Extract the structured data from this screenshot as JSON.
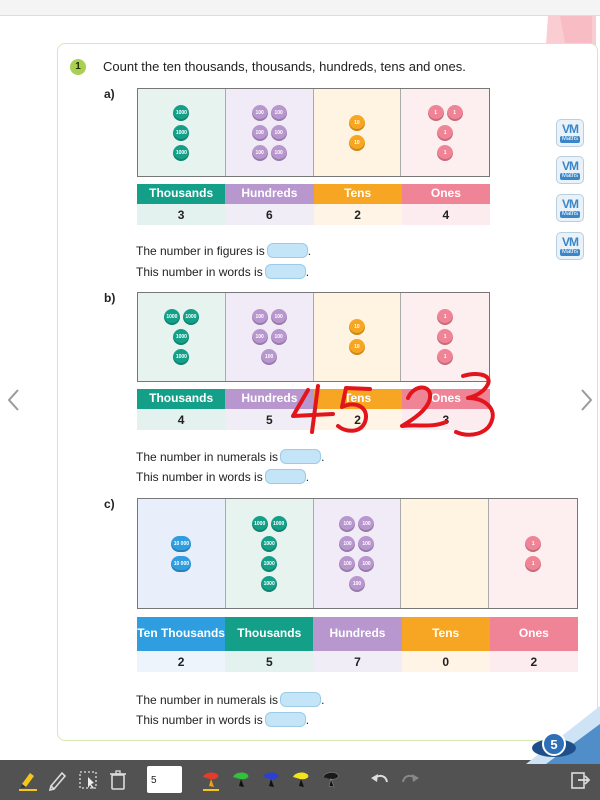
{
  "prompt": {
    "number": "1",
    "text": "Count the ten thousands, thousands, hundreds, tens and ones."
  },
  "colors": {
    "tt": "#2f9ee0",
    "th": "#14a088",
    "hu": "#b896ce",
    "te": "#f6a622",
    "on": "#f08497"
  },
  "parts": [
    {
      "label": "a)",
      "board": [
        {
          "kind": "th",
          "rows": [
            [
              "1000"
            ],
            [
              "1000"
            ],
            [
              "1000"
            ]
          ]
        },
        {
          "kind": "hu",
          "rows": [
            [
              "100",
              "100"
            ],
            [
              "100",
              "100"
            ],
            [
              "100",
              "100"
            ]
          ]
        },
        {
          "kind": "te",
          "rows": [
            [
              "10"
            ],
            [
              "10"
            ]
          ]
        },
        {
          "kind": "on",
          "rows": [
            [
              "1",
              "1"
            ],
            [
              "1"
            ],
            [
              "1"
            ]
          ]
        }
      ],
      "headers": [
        "Thousands",
        "Hundreds",
        "Tens",
        "Ones"
      ],
      "values": [
        "3",
        "6",
        "2",
        "4"
      ],
      "line1": "The number in figures is",
      "line2": "This number in words is"
    },
    {
      "label": "b)",
      "board": [
        {
          "kind": "th",
          "rows": [
            [
              "1000",
              "1000"
            ],
            [
              "1000"
            ],
            [
              "1000"
            ]
          ]
        },
        {
          "kind": "hu",
          "rows": [
            [
              "100",
              "100"
            ],
            [
              "100",
              "100"
            ],
            [
              "100"
            ]
          ]
        },
        {
          "kind": "te",
          "rows": [
            [
              "10"
            ],
            [
              "10"
            ]
          ]
        },
        {
          "kind": "on",
          "rows": [
            [
              "1"
            ],
            [
              "1"
            ],
            [
              "1"
            ]
          ]
        }
      ],
      "headers": [
        "Thousands",
        "Hundreds",
        "Tens",
        "Ones"
      ],
      "values": [
        "4",
        "5",
        "2",
        "3"
      ],
      "line1": "The number in numerals is",
      "line2": "This number in words is"
    },
    {
      "label": "c)",
      "board": [
        {
          "kind": "tt",
          "rows": [
            [
              "10 000"
            ],
            [
              "10 000"
            ]
          ]
        },
        {
          "kind": "th",
          "rows": [
            [
              "1000",
              "1000"
            ],
            [
              "1000"
            ],
            [
              "1000"
            ],
            [
              "1000"
            ]
          ]
        },
        {
          "kind": "hu",
          "rows": [
            [
              "100",
              "100"
            ],
            [
              "100",
              "100"
            ],
            [
              "100",
              "100"
            ],
            [
              "100"
            ]
          ]
        },
        {
          "kind": "te",
          "rows": []
        },
        {
          "kind": "on",
          "rows": [
            [
              "1"
            ],
            [
              "1"
            ]
          ]
        }
      ],
      "headers": [
        "Ten Thousands",
        "Thousands",
        "Hundreds",
        "Tens",
        "Ones"
      ],
      "values": [
        "2",
        "5",
        "7",
        "0",
        "2"
      ],
      "line1": "The number in numerals is",
      "line2": "This number in words is"
    }
  ],
  "handwriting": "4523",
  "vm_badge": {
    "top": "VM",
    "bottom": "Maths"
  },
  "toolbar": {
    "page_value": "5",
    "tools": [
      "highlighter-icon",
      "pencil-icon",
      "pointer-icon",
      "trash-icon",
      "pen-red-icon",
      "pen-green-icon",
      "pen-blue-icon",
      "pen-yellow-icon",
      "pen-black-icon",
      "undo-icon",
      "redo-icon",
      "exit-icon"
    ]
  },
  "logo": "5"
}
